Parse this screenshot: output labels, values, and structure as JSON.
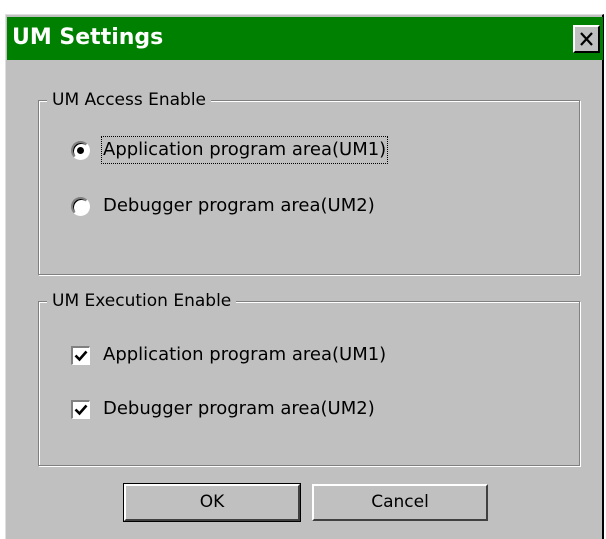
{
  "dialog": {
    "title": "UM Settings",
    "close_icon": "close-x-icon",
    "titlebar_color": "#008000",
    "face_color": "#c0c0c0"
  },
  "access_group": {
    "legend": "UM Access Enable",
    "options": [
      {
        "label": "Application program area(UM1)",
        "selected": true
      },
      {
        "label": "Debugger program area(UM2)",
        "selected": false
      }
    ]
  },
  "execution_group": {
    "legend": "UM Execution Enable",
    "options": [
      {
        "label": "Application program area(UM1)",
        "checked": true
      },
      {
        "label": "Debugger program area(UM2)",
        "checked": true
      }
    ]
  },
  "buttons": {
    "ok": "OK",
    "cancel": "Cancel"
  }
}
